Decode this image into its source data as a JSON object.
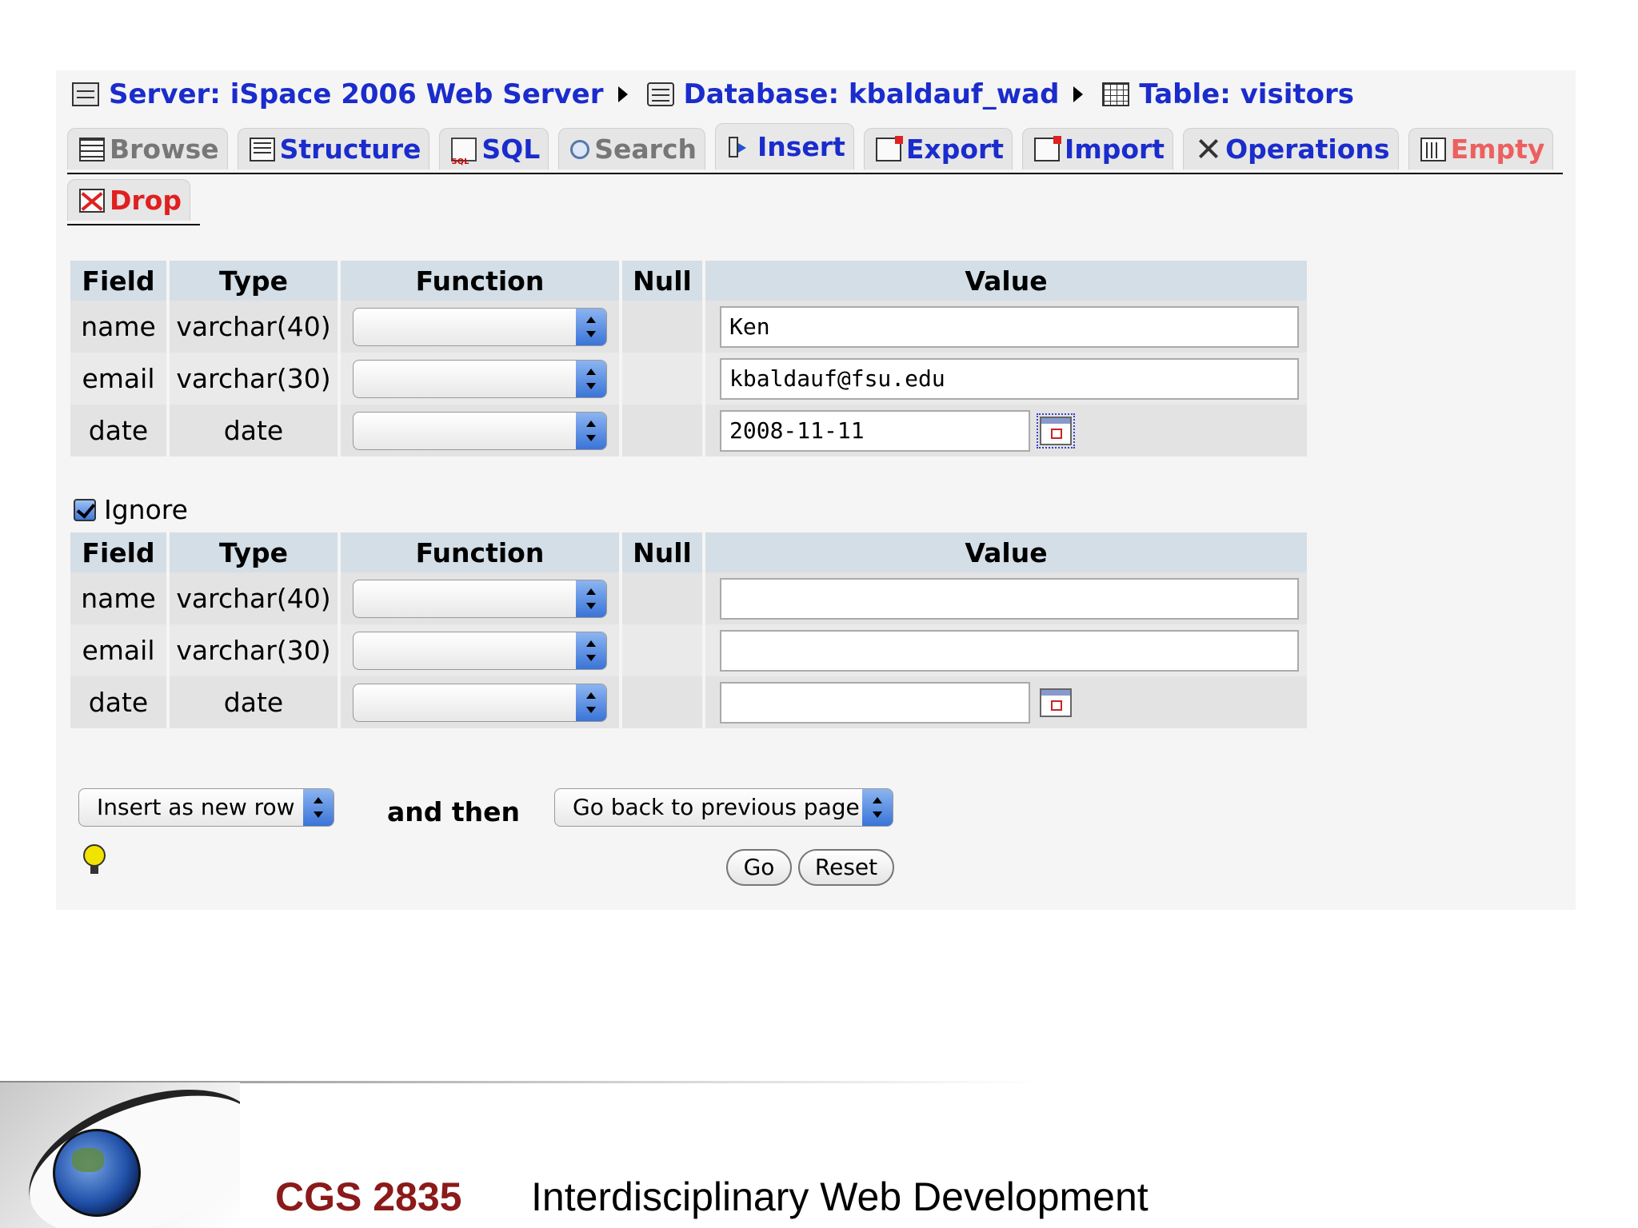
{
  "breadcrumbs": [
    {
      "label": "Server: iSpace 2006 Web Server",
      "icon": "server-icon"
    },
    {
      "label": "Database: kbaldauf_wad",
      "icon": "database-icon"
    },
    {
      "label": "Table: visitors",
      "icon": "table-icon"
    }
  ],
  "tabs": [
    {
      "label": "Browse",
      "icon": "browse-icon",
      "state": "disabled"
    },
    {
      "label": "Structure",
      "icon": "structure-icon"
    },
    {
      "label": "SQL",
      "icon": "sql-icon"
    },
    {
      "label": "Search",
      "icon": "search-icon",
      "state": "disabled"
    },
    {
      "label": "Insert",
      "icon": "insert-icon",
      "state": "active"
    },
    {
      "label": "Export",
      "icon": "export-icon"
    },
    {
      "label": "Import",
      "icon": "import-icon"
    },
    {
      "label": "Operations",
      "icon": "operations-icon"
    },
    {
      "label": "Empty",
      "icon": "empty-icon",
      "state": "danger-disabled"
    },
    {
      "label": "Drop",
      "icon": "drop-icon",
      "state": "danger"
    }
  ],
  "columns": {
    "field": "Field",
    "type": "Type",
    "function": "Function",
    "null": "Null",
    "value": "Value"
  },
  "insert_1": [
    {
      "field": "name",
      "type": "varchar(40)",
      "value": "Ken"
    },
    {
      "field": "email",
      "type": "varchar(30)",
      "value": "kbaldauf@fsu.edu"
    },
    {
      "field": "date",
      "type": "date",
      "value": "2008-11-11"
    }
  ],
  "ignore": {
    "label": "Ignore",
    "checked": true
  },
  "insert_2": [
    {
      "field": "name",
      "type": "varchar(40)",
      "value": ""
    },
    {
      "field": "email",
      "type": "varchar(30)",
      "value": ""
    },
    {
      "field": "date",
      "type": "date",
      "value": ""
    }
  ],
  "bottom": {
    "insert_mode": "Insert as new row",
    "and_then": "and then",
    "after_action": "Go back to previous page",
    "go": "Go",
    "reset": "Reset"
  },
  "footer": {
    "course_code": "CGS 2835",
    "course_title": "Interdisciplinary Web Development"
  },
  "colors": {
    "link": "#1a2ccc",
    "danger": "#e02020",
    "course_code": "#8b1a1a",
    "header_bg": "#d4dee6"
  }
}
